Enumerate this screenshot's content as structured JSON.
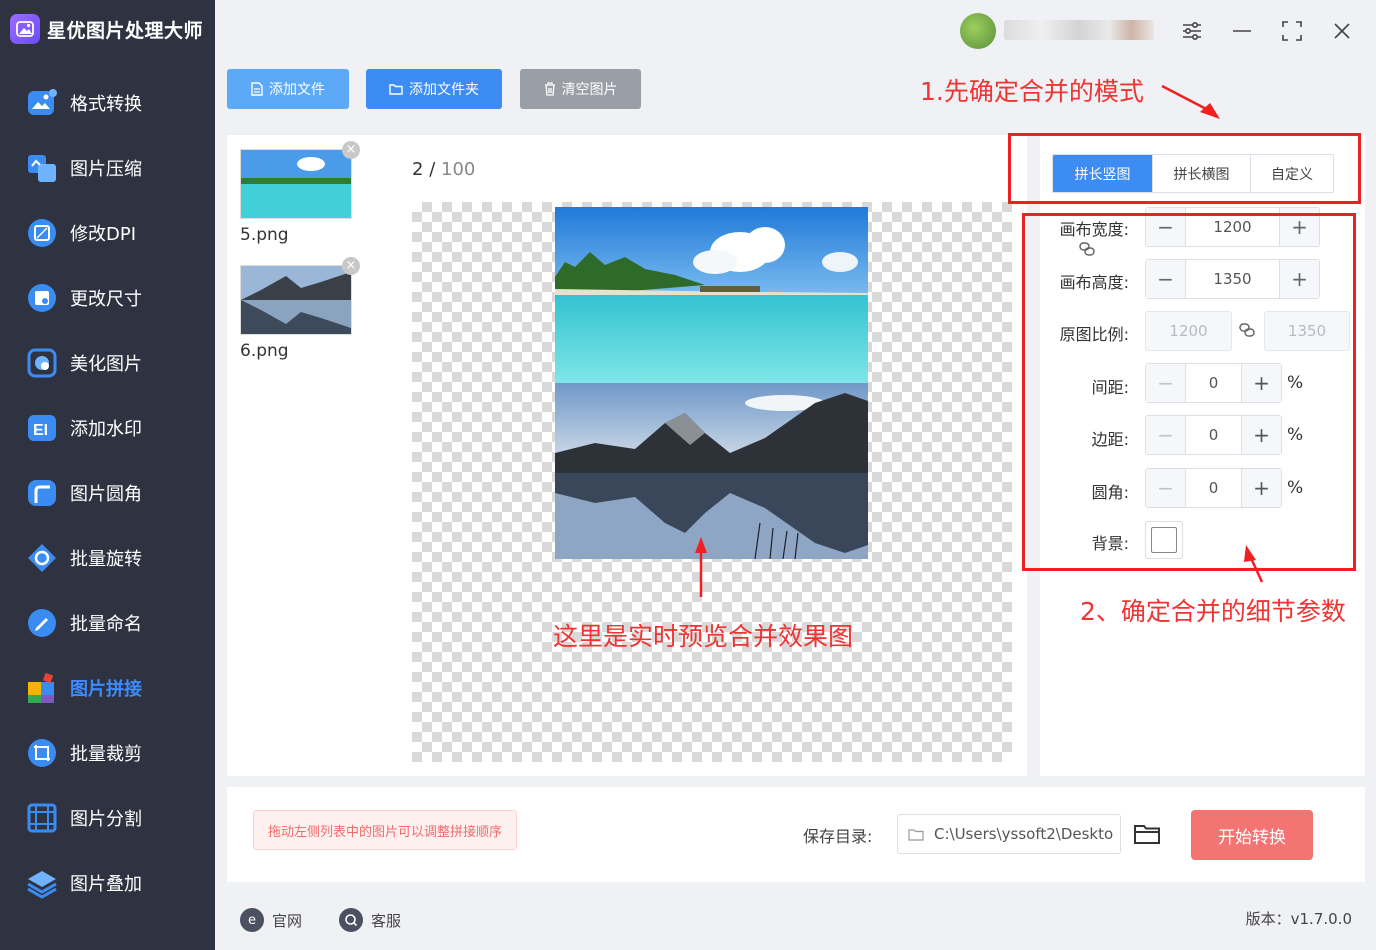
{
  "app": {
    "title": "星优图片处理大师"
  },
  "sidebar": {
    "items": [
      {
        "label": "格式转换",
        "icon": "image-convert-icon"
      },
      {
        "label": "图片压缩",
        "icon": "compress-icon"
      },
      {
        "label": "修改DPI",
        "icon": "dpi-icon"
      },
      {
        "label": "更改尺寸",
        "icon": "resize-icon"
      },
      {
        "label": "美化图片",
        "icon": "beautify-icon"
      },
      {
        "label": "添加水印",
        "icon": "watermark-icon"
      },
      {
        "label": "图片圆角",
        "icon": "round-corner-icon"
      },
      {
        "label": "批量旋转",
        "icon": "rotate-icon"
      },
      {
        "label": "批量命名",
        "icon": "rename-icon"
      },
      {
        "label": "图片拼接",
        "icon": "puzzle-icon",
        "active": true
      },
      {
        "label": "批量裁剪",
        "icon": "crop-icon"
      },
      {
        "label": "图片分割",
        "icon": "split-icon"
      },
      {
        "label": "图片叠加",
        "icon": "layers-icon"
      }
    ]
  },
  "toolbar": {
    "add_file": "添加文件",
    "add_folder": "添加文件夹",
    "clear": "清空图片"
  },
  "files": [
    {
      "name": "5.png",
      "thumb": "beach"
    },
    {
      "name": "6.png",
      "thumb": "lake"
    }
  ],
  "preview": {
    "current": "2",
    "separator": "/",
    "total": "100"
  },
  "modes": {
    "vertical": "拼长竖图",
    "horizontal": "拼长横图",
    "custom": "自定义"
  },
  "settings": {
    "canvas_width_label": "画布宽度:",
    "canvas_width": "1200",
    "canvas_height_label": "画布高度:",
    "canvas_height": "1350",
    "ratio_label": "原图比例:",
    "ratio_w": "1200",
    "ratio_h": "1350",
    "spacing_label": "间距:",
    "spacing": "0",
    "margin_label": "边距:",
    "margin": "0",
    "radius_label": "圆角:",
    "radius": "0",
    "percent": "%",
    "background_label": "背景:",
    "minus": "−",
    "plus": "+"
  },
  "bottom": {
    "hint": "拖动左侧列表中的图片可以调整拼接顺序",
    "save_label": "保存目录:",
    "save_path": "C:\\Users\\yssoft2\\Deskto",
    "start": "开始转换"
  },
  "footer": {
    "website": "官网",
    "service": "客服",
    "version": "版本：v1.7.0.0"
  },
  "annotations": {
    "step1": "1.先确定合并的模式",
    "step2": "2、确定合并的细节参数",
    "preview_note": "这里是实时预览合并效果图",
    "color": "#f03333"
  },
  "colors": {
    "sidebar_bg": "#2f3341",
    "accent": "#3c8cf4",
    "start_button": "#f47373"
  }
}
